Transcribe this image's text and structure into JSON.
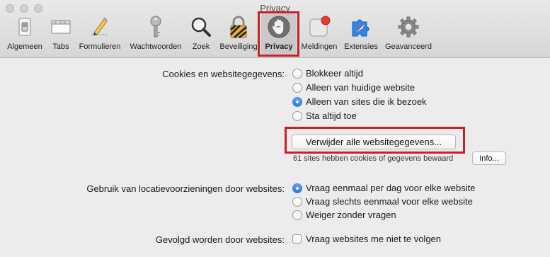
{
  "window": {
    "title": "Privacy"
  },
  "toolbar": {
    "items": [
      {
        "label": "Algemeen",
        "icon": "switch-icon"
      },
      {
        "label": "Tabs",
        "icon": "tabs-icon"
      },
      {
        "label": "Formulieren",
        "icon": "pencil-icon"
      },
      {
        "label": "Wachtwoorden",
        "icon": "key-icon"
      },
      {
        "label": "Zoek",
        "icon": "search-icon"
      },
      {
        "label": "Beveiliging",
        "icon": "lock-icon"
      },
      {
        "label": "Privacy",
        "icon": "hand-icon",
        "selected": true
      },
      {
        "label": "Meldingen",
        "icon": "notification-icon"
      },
      {
        "label": "Extensies",
        "icon": "puzzle-icon"
      },
      {
        "label": "Geavanceerd",
        "icon": "gear-icon"
      }
    ]
  },
  "cookies": {
    "label": "Cookies en websitegegevens:",
    "options": [
      {
        "label": "Blokkeer altijd",
        "selected": false
      },
      {
        "label": "Alleen van huidige website",
        "selected": false
      },
      {
        "label": "Alleen van sites die ik bezoek",
        "selected": true
      },
      {
        "label": "Sta altijd toe",
        "selected": false
      }
    ],
    "remove_button": "Verwijder alle websitegegevens...",
    "stored_text": "61 sites hebben cookies of gegevens bewaard",
    "info_button": "Info..."
  },
  "location": {
    "label": "Gebruik van locatievoorzieningen door websites:",
    "options": [
      {
        "label": "Vraag eenmaal per dag voor elke website",
        "selected": true
      },
      {
        "label": "Vraag slechts eenmaal voor elke website",
        "selected": false
      },
      {
        "label": "Weiger zonder vragen",
        "selected": false
      }
    ]
  },
  "tracking": {
    "label": "Gevolgd worden door websites:",
    "checkbox_label": "Vraag websites me niet te volgen",
    "checked": false
  },
  "colors": {
    "highlight": "#c8202a",
    "accent": "#3a82e6"
  }
}
